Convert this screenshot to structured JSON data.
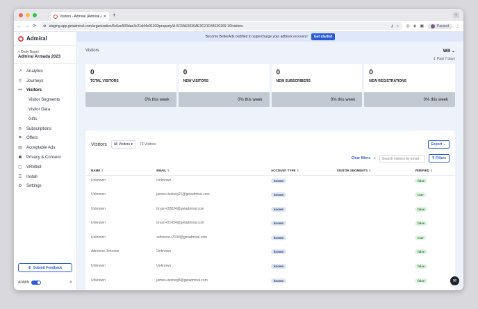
{
  "browser": {
    "tab_title": "Visitors - Admiral (Admiral Ar…",
    "new_tab": "+",
    "url": "staging.app.getadmiral.com/organization/5c6ae503dae3c21d44e91169/property/A-5C6AE5030AE3C21D44E91169-16/visitors",
    "profile": "Paused"
  },
  "sidebar": {
    "logo": "Admiral",
    "org_sub": "< Daily Bagel",
    "org_name": "Admiral Armada 2023",
    "items": [
      {
        "label": "Analytics",
        "icon": "↗",
        "sub": false,
        "active": false
      },
      {
        "label": "Journeys",
        "icon": "⚲",
        "sub": false,
        "active": false
      },
      {
        "label": "Visitors",
        "icon": "⚯",
        "sub": false,
        "active": true
      },
      {
        "label": "Visitor Segments",
        "icon": "",
        "sub": true,
        "active": false
      },
      {
        "label": "Visitor Data",
        "icon": "",
        "sub": true,
        "active": false
      },
      {
        "label": "Gifts",
        "icon": "",
        "sub": true,
        "active": false
      },
      {
        "label": "Subscriptions",
        "icon": "⟳",
        "sub": false,
        "active": false
      },
      {
        "label": "Offers",
        "icon": "⚑",
        "sub": false,
        "active": false
      },
      {
        "label": "Acceptable Ads",
        "icon": "▤",
        "sub": false,
        "active": false
      },
      {
        "label": "Privacy & Consent",
        "icon": "☗",
        "sub": false,
        "active": false
      },
      {
        "label": "VRMbot",
        "icon": "▢",
        "sub": false,
        "active": false
      },
      {
        "label": "Install",
        "icon": "☰",
        "sub": false,
        "active": false
      },
      {
        "label": "Settings",
        "icon": "⚙",
        "sub": false,
        "active": false
      }
    ],
    "feedback": "Submit Feedback",
    "admin": "ADMIN"
  },
  "banner": {
    "text": "Become BetterAds certified to supercharge your adblock recovery!",
    "cta": "Get started"
  },
  "page": {
    "title": "Visitors",
    "user": "Will ⌄",
    "range": "Past 7 days"
  },
  "cards": [
    {
      "value": "0",
      "label": "TOTAL VISITORS",
      "footer": "0% this week"
    },
    {
      "value": "0",
      "label": "NEW VISITORS",
      "footer": "0% this week"
    },
    {
      "value": "0",
      "label": "NEW SUBSCRIBERS",
      "footer": "0% this week"
    },
    {
      "value": "0",
      "label": "NEW REGISTRATIONS",
      "footer": "0% this week"
    }
  ],
  "table": {
    "title": "Visitors",
    "filter": "All Visitors ▾",
    "count": "73 Visitors",
    "export": "Export ⌄",
    "clear": "Clear filters",
    "search_placeholder": "Search visitors by email",
    "filters": "Filters",
    "columns": [
      "NAME",
      "EMAIL",
      "ACCOUNT TYPE",
      "VISITOR SEGMENTS",
      "VERIFIED"
    ],
    "rows": [
      [
        "Unknown",
        "Unknown",
        "known",
        "",
        "false"
      ],
      [
        "Unknown",
        "james+testreg21@getadmiral.com",
        "known",
        "",
        "true"
      ],
      [
        "Unknown",
        "bryan+32824@getadmiral.com",
        "known",
        "",
        "false"
      ],
      [
        "Unknown",
        "bryan+21424@getadmiral.com",
        "known",
        "",
        "false"
      ],
      [
        "Unknown",
        "adrienne+7109@getadmiral.com",
        "known",
        "",
        "true"
      ],
      [
        "Adrienne Johnson",
        "Unknown",
        "known",
        "",
        "false"
      ],
      [
        "Unknown",
        "Unknown",
        "known",
        "",
        "false"
      ],
      [
        "Unknown",
        "james+testreg8@getadmiral.com",
        "known",
        "",
        "false"
      ]
    ]
  }
}
